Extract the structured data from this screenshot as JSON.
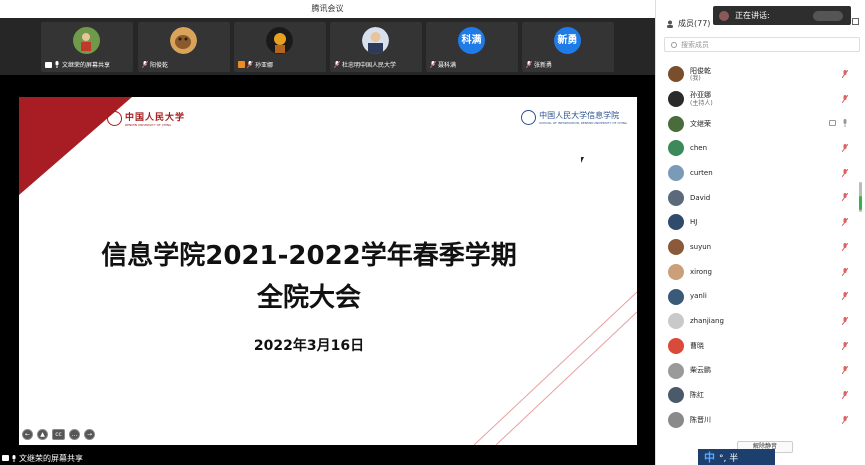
{
  "window": {
    "title": "腾讯会议"
  },
  "strip": {
    "thumbs": [
      {
        "name": "文继荣的屏幕共享",
        "avatar_color": "#5b7a3a",
        "kind": "photo"
      },
      {
        "name": "阳俊乾",
        "avatar_color": "#7a4d2b",
        "kind": "photo"
      },
      {
        "name": "孙亚娜",
        "avatar_color": "#2a2a2a",
        "kind": "photo"
      },
      {
        "name": "杜忠明中国人民大学",
        "avatar_color": "#5d6c8a",
        "kind": "photo"
      },
      {
        "name": "聂科满",
        "avatar_text": "科满",
        "kind": "text"
      },
      {
        "name": "张新勇",
        "avatar_text": "新勇",
        "kind": "text"
      }
    ]
  },
  "slide": {
    "logo_left_cn": "中国人民大学",
    "logo_left_en": "RENMIN UNIVERSITY OF CHINA",
    "logo_right_cn": "中国人民大学信息学院",
    "logo_right_en": "SCHOOL OF INFORMATION, RENMIN UNIVERSITY OF CHINA",
    "title_line1": "信息学院2021-2022学年春季学期",
    "title_line2": "全院大会",
    "date": "2022年3月16日"
  },
  "share_label": "文继荣的屏幕共享",
  "panel": {
    "header": "成员(77)",
    "speaking": "正在讲话:",
    "search_placeholder": "搜索成员",
    "members": [
      {
        "name": "阳俊乾",
        "role": "(我)",
        "color": "#7a4d2b",
        "muted": true
      },
      {
        "name": "孙亚娜",
        "role": "(主持人)",
        "color": "#2a2a2a",
        "muted": true
      },
      {
        "name": "文继荣",
        "role": "",
        "color": "#4a6b3a",
        "muted": false,
        "sharing": true
      },
      {
        "name": "chen",
        "role": "",
        "color": "#3c8a5a",
        "muted": true
      },
      {
        "name": "curten",
        "role": "",
        "color": "#7b9ab8",
        "muted": true
      },
      {
        "name": "David",
        "role": "",
        "color": "#5a6a7a",
        "muted": true
      },
      {
        "name": "HJ",
        "role": "",
        "color": "#2f4a6a",
        "muted": true
      },
      {
        "name": "suyun",
        "role": "",
        "color": "#8a5a3a",
        "muted": true
      },
      {
        "name": "xirong",
        "role": "",
        "color": "#c9a07a",
        "muted": true
      },
      {
        "name": "yanli",
        "role": "",
        "color": "#3a5a7a",
        "muted": true
      },
      {
        "name": "zhanjiang",
        "role": "",
        "color": "#c9c9c9",
        "muted": true
      },
      {
        "name": "曹晓",
        "role": "",
        "color": "#d94a3a",
        "muted": true
      },
      {
        "name": "柴云鹏",
        "role": "",
        "color": "#9a9a9a",
        "muted": true
      },
      {
        "name": "陈红",
        "role": "",
        "color": "#4a5a6a",
        "muted": true
      },
      {
        "name": "陈晋川",
        "role": "",
        "color": "#8a8a8a",
        "muted": true
      }
    ],
    "unmute_all": "解除静音"
  },
  "ime": {
    "lang": "中",
    "mode": "°, 半"
  },
  "colors": {
    "accent_red": "#a31c1c",
    "brand_blue": "#1e7be8",
    "muted_red": "#e06060"
  }
}
